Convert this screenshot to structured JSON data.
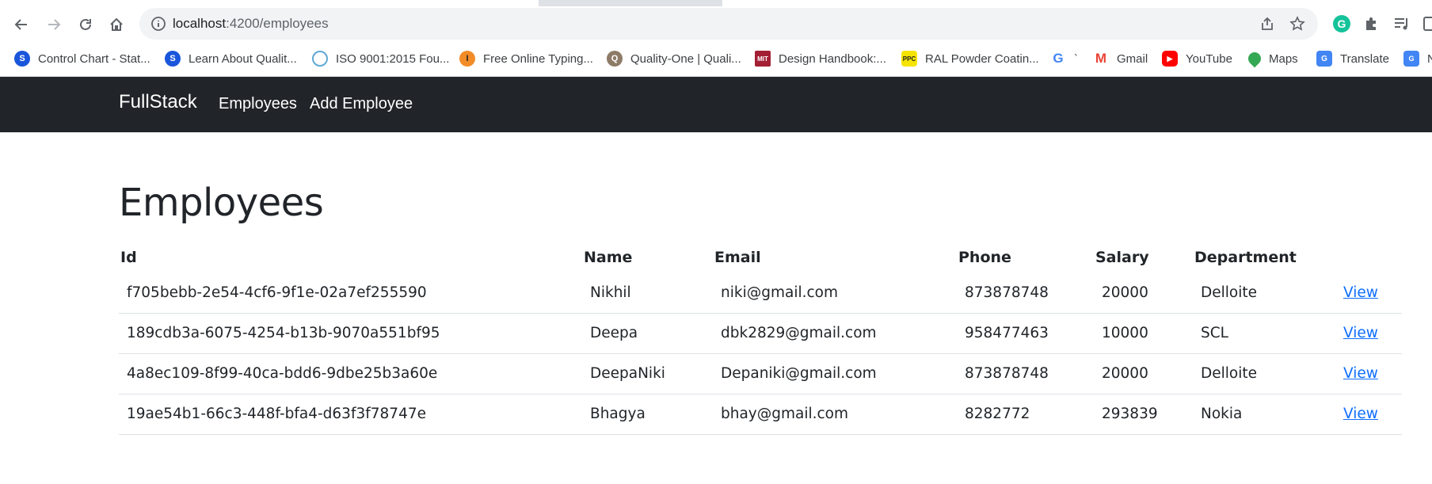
{
  "browser": {
    "url_host": "localhost",
    "url_path": ":4200/employees",
    "bookmarks": [
      {
        "label": "Control Chart - Stat...",
        "icon": "stat-favicon",
        "color": "#1a56db"
      },
      {
        "label": "Learn About Qualit...",
        "icon": "stat-favicon",
        "color": "#1a56db"
      },
      {
        "label": "ISO 9001:2015 Fou...",
        "icon": "cloud-favicon",
        "color": "#5fa8d3"
      },
      {
        "label": "Free Online Typing...",
        "icon": "typing-favicon",
        "color": "#f28c28"
      },
      {
        "label": "Quality-One | Quali...",
        "icon": "qi-favicon",
        "color": "#8d7b68"
      },
      {
        "label": "Design Handbook:...",
        "icon": "mit-favicon",
        "color": "#a31f34"
      },
      {
        "label": "RAL Powder Coatin...",
        "icon": "ppc-favicon",
        "color": "#f5e400"
      },
      {
        "label": "`",
        "icon": "google-favicon",
        "color": "#4285f4"
      },
      {
        "label": "Gmail",
        "icon": "gmail-favicon",
        "color": "#ea4335"
      },
      {
        "label": "YouTube",
        "icon": "youtube-favicon",
        "color": "#ff0000"
      },
      {
        "label": "Maps",
        "icon": "maps-favicon",
        "color": "#34a853"
      },
      {
        "label": "Translate",
        "icon": "translate-favicon",
        "color": "#4285f4"
      },
      {
        "label": "N",
        "icon": "new-favicon",
        "color": "#4285f4"
      }
    ]
  },
  "navbar": {
    "brand": "FullStack",
    "links": [
      "Employees",
      "Add Employee"
    ],
    "background": "#212529"
  },
  "main": {
    "title": "Employees",
    "columns": [
      "Id",
      "Name",
      "Email",
      "Phone",
      "Salary",
      "Department",
      ""
    ],
    "rows": [
      {
        "id": "f705bebb-2e54-4cf6-9f1e-02a7ef255590",
        "name": "Nikhil",
        "email": "niki@gmail.com",
        "phone": "873878748",
        "salary": "20000",
        "department": "Delloite",
        "action": "View"
      },
      {
        "id": "189cdb3a-6075-4254-b13b-9070a551bf95",
        "name": "Deepa",
        "email": "dbk2829@gmail.com",
        "phone": "958477463",
        "salary": "10000",
        "department": "SCL",
        "action": "View"
      },
      {
        "id": "4a8ec109-8f99-40ca-bdd6-9dbe25b3a60e",
        "name": "DeepaNiki",
        "email": "Depaniki@gmail.com",
        "phone": "873878748",
        "salary": "20000",
        "department": "Delloite",
        "action": "View"
      },
      {
        "id": "19ae54b1-66c3-448f-bfa4-d63f3f78747e",
        "name": "Bhagya",
        "email": "bhay@gmail.com",
        "phone": "8282772",
        "salary": "293839",
        "department": "Nokia",
        "action": "View"
      }
    ],
    "link_color": "#0d6efd"
  }
}
